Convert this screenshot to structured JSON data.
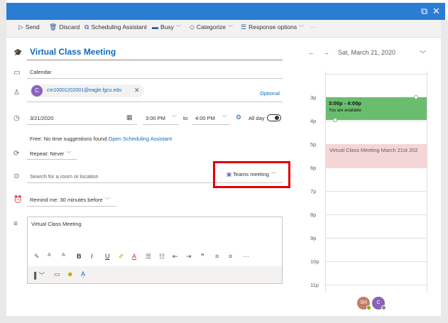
{
  "window": {
    "restore_icon": "restore-icon",
    "close_icon": "close-icon"
  },
  "toolbar": {
    "send": "Send",
    "discard": "Discard",
    "scheduling": "Scheduling Assistant",
    "busy": "Busy",
    "categorize": "Categorize",
    "response": "Response options",
    "more": "···"
  },
  "form": {
    "title": "Virtual Class Meeting",
    "calendar": "Calendar",
    "attendee_initial": "C",
    "attendee_email": "cm10001202001@eagle.fgcu.edu",
    "optional": "Optional",
    "date": "3/21/2020",
    "start_time": "3:00 PM",
    "to": "to",
    "end_time": "4:00 PM",
    "all_day": "All day",
    "free_text": "Free:  No time suggestions found.",
    "open_assistant": "Open Scheduling Assistant",
    "repeat": "Repeat: Never",
    "location_placeholder": "Search for a room or location",
    "teams": "Teams meeting",
    "remind": "Remind me: 30 minutes before",
    "body": "Virtual Class Meeting"
  },
  "calendar": {
    "date": "Sat, March 21, 2020",
    "hours": [
      "3p",
      "4p",
      "5p",
      "6p",
      "7p",
      "8p",
      "9p",
      "10p",
      "11p"
    ],
    "avail_time": "3:00p - 4:00p",
    "avail_status": "You are available",
    "event": "Virtual Class Meeting March 21st 202",
    "attendees": [
      {
        "initials": "SH",
        "color": "#c47c6b",
        "badge": "#6bb700"
      },
      {
        "initials": "C",
        "color": "#8764b8",
        "badge": "#8a8886"
      }
    ]
  },
  "colors": {
    "titlebar": "#2b7cd3",
    "accent": "#0f6cbd",
    "available": "#6abd6e",
    "event": "#f4d6d6",
    "highlight_box": "#e00000"
  }
}
